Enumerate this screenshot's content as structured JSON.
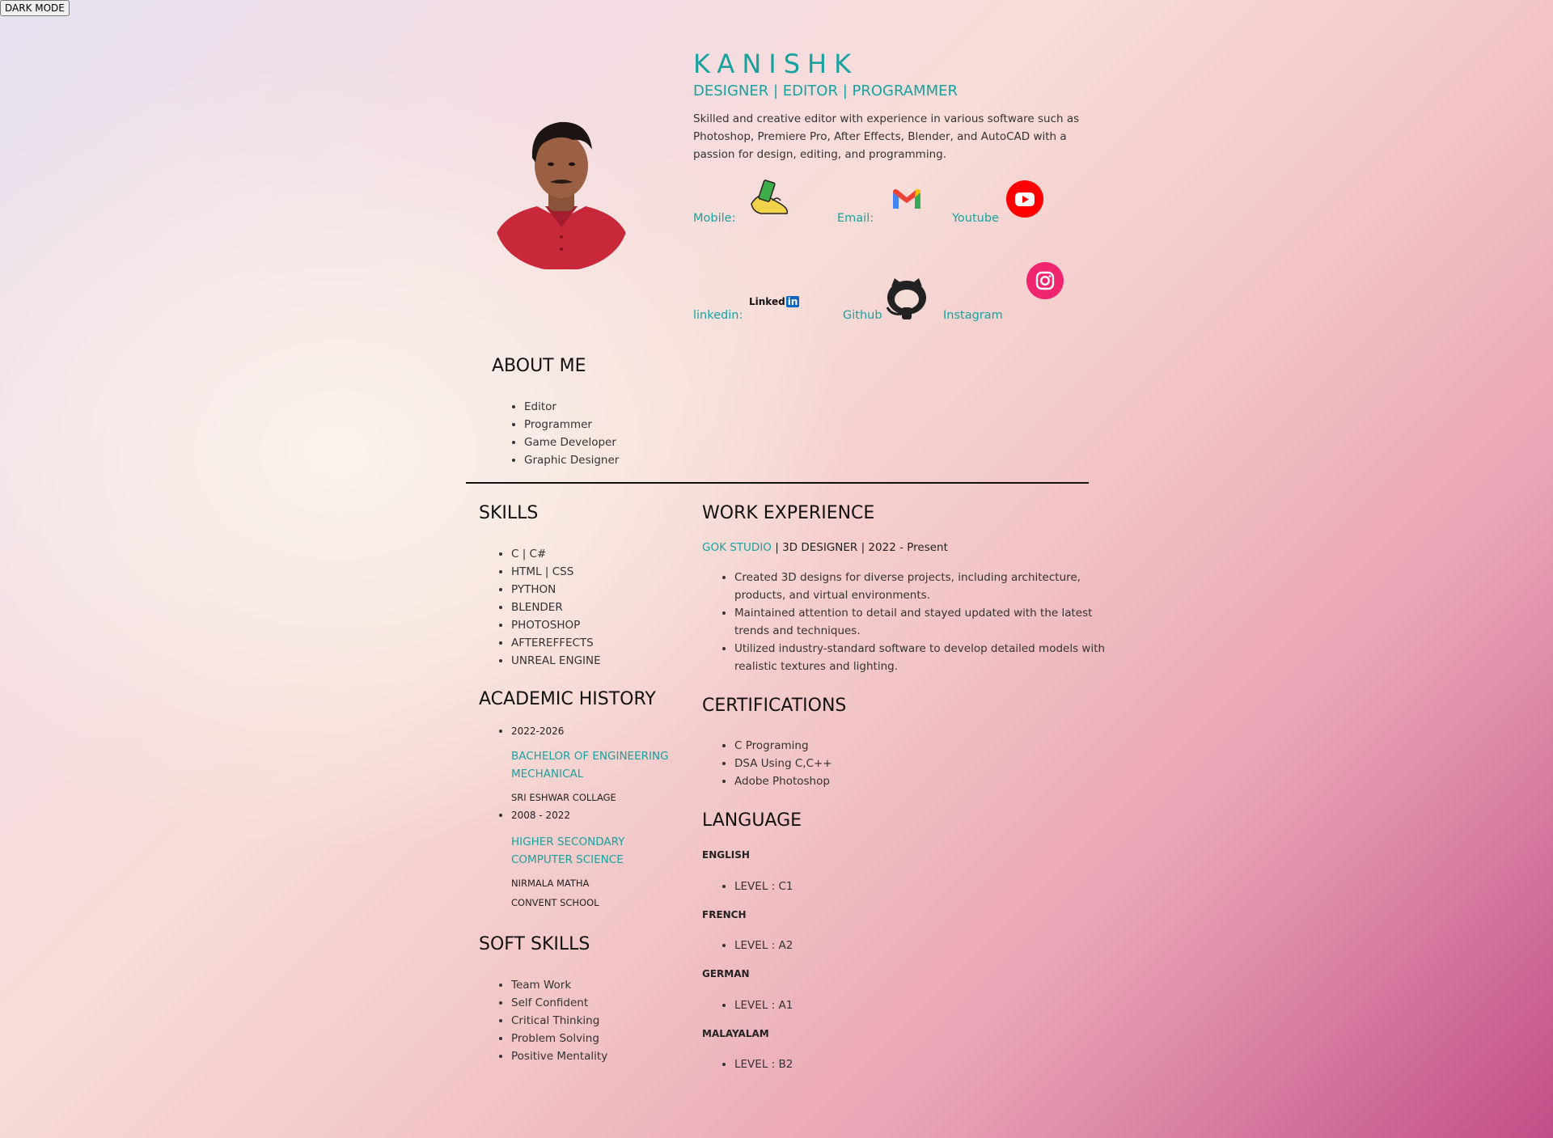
{
  "toolbar": {
    "dark_mode_label": "DARK MODE"
  },
  "header": {
    "name": "KANISHK",
    "role": "DESIGNER | EDITOR | PROGRAMMER",
    "intro": "Skilled and creative editor with experience in various software such as Photoshop, Premiere Pro, After Effects, Blender, and AutoCAD with a passion for design, editing, and programming."
  },
  "contacts": {
    "mobile": "Mobile:",
    "email": "Email:",
    "youtube": "Youtube",
    "linkedin": "linkedin:",
    "linkedin_logo": "Linked",
    "linkedin_in": "in",
    "github": "Github",
    "instagram": "Instagram"
  },
  "about": {
    "title": "ABOUT ME",
    "items": [
      "Editor",
      "Programmer",
      "Game Developer",
      "Graphic Designer"
    ]
  },
  "skills": {
    "title": "SKILLS",
    "items": [
      "C | C#",
      "HTML | CSS",
      "PYTHON",
      "BLENDER",
      "PHOTOSHOP",
      "AFTEREFFECTS",
      "UNREAL ENGINE"
    ]
  },
  "academic": {
    "title": "ACADEMIC HISTORY",
    "entries": [
      {
        "years": "2022-2026",
        "degree_1": "BACHELOR OF ENGINEERING",
        "degree_2": "MECHANICAL",
        "school_1": "SRI ESHWAR COLLAGE",
        "school_2": ""
      },
      {
        "years": "2008 - 2022",
        "degree_1": "HIGHER SECONDARY",
        "degree_2": "COMPUTER SCIENCE",
        "school_1": "NIRMALA MATHA",
        "school_2": "CONVENT SCHOOL"
      }
    ]
  },
  "soft_skills": {
    "title": "SOFT SKILLS",
    "items": [
      "Team Work",
      "Self Confident",
      "Critical Thinking",
      "Problem Solving",
      "Positive Mentality"
    ]
  },
  "work": {
    "title": "WORK EXPERIENCE",
    "company": "GOK STUDIO",
    "details": " | 3D DESIGNER | 2022 - Present",
    "bullets": [
      "Created 3D designs for diverse projects, including architecture, products, and virtual environments.",
      "Maintained attention to detail and stayed updated with the latest trends and techniques.",
      "Utilized industry-standard software to develop detailed models with realistic textures and lighting."
    ]
  },
  "certifications": {
    "title": "CERTIFICATIONS",
    "items": [
      "C Programing",
      "DSA Using C,C++",
      "Adobe Photoshop"
    ]
  },
  "language": {
    "title": "LANGUAGE",
    "entries": [
      {
        "name": "ENGLISH",
        "level": "LEVEL : C1"
      },
      {
        "name": "FRENCH",
        "level": "LEVEL : A2"
      },
      {
        "name": "GERMAN",
        "level": "LEVEL : A1"
      },
      {
        "name": "MALAYALAM",
        "level": "LEVEL : B2"
      }
    ]
  },
  "colors": {
    "accent": "#17a2a0",
    "youtube": "#ff0000",
    "instagram": "#f0246f",
    "linkedin": "#0a66c2"
  },
  "icons": [
    "hand-phone-icon",
    "gmail-icon",
    "youtube-icon",
    "linkedin-icon",
    "github-icon",
    "instagram-icon"
  ]
}
